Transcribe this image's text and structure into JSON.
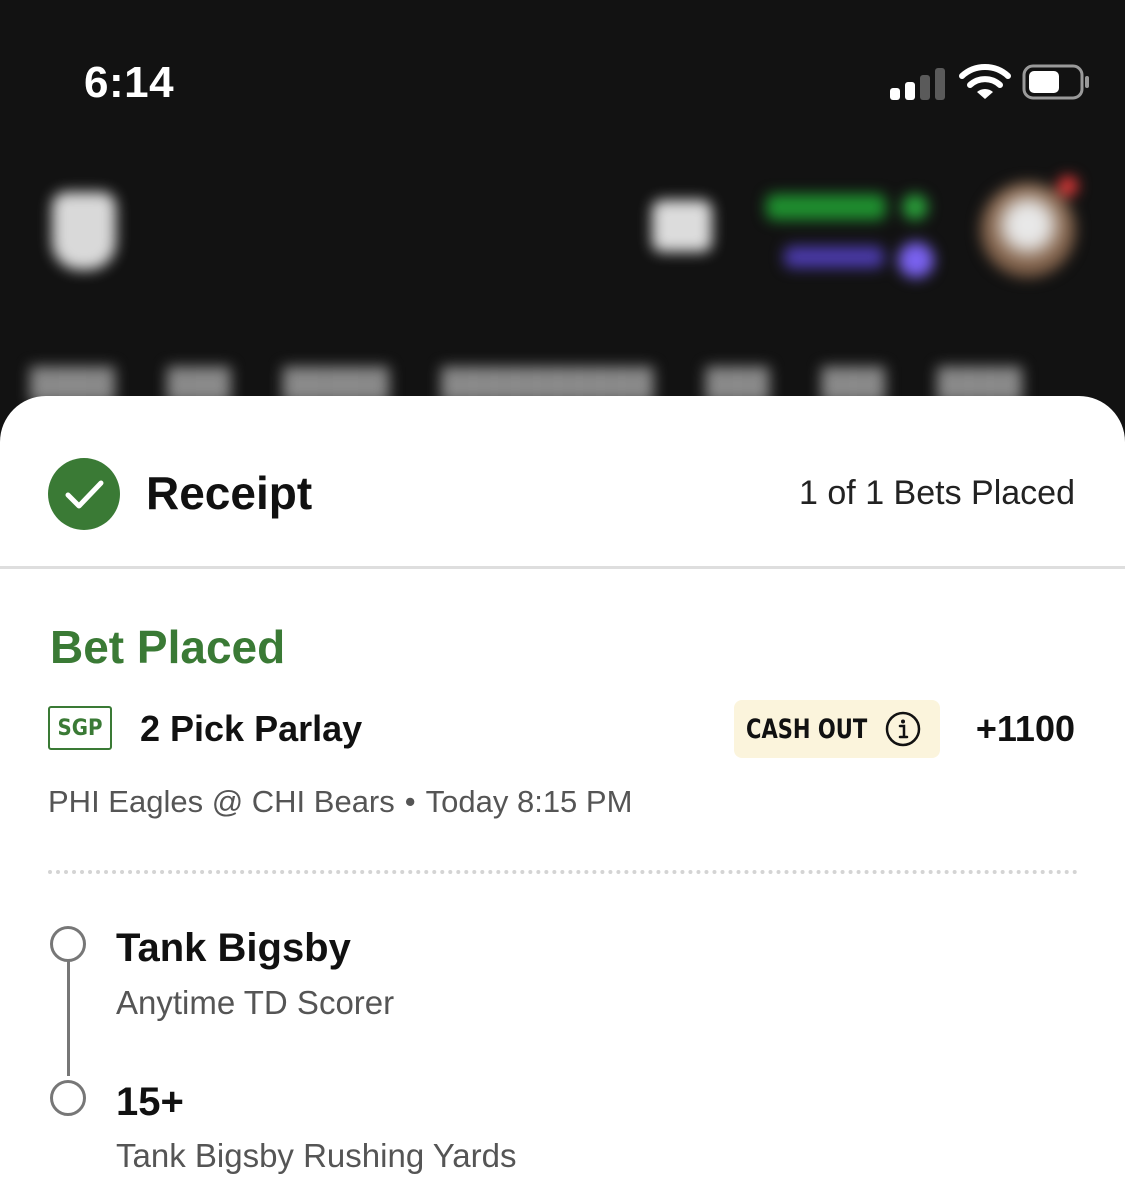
{
  "status_bar": {
    "time": "6:14",
    "icons": [
      "cellular-signal-icon",
      "wifi-icon",
      "battery-icon"
    ]
  },
  "app_header": {
    "icons": [
      "crown-logo-icon",
      "gift-icon",
      "add-funds-icon",
      "bonus-icon",
      "avatar"
    ]
  },
  "receipt": {
    "title": "Receipt",
    "bets_count": "1 of 1 Bets Placed",
    "status_color": "#3a7a35"
  },
  "bet": {
    "status": "Bet Placed",
    "badge": "SGP",
    "title": "2 Pick Parlay",
    "cash_out_label": "CASH OUT",
    "odds": "+1100",
    "matchup": "PHI Eagles @ CHI Bears",
    "separator": "•",
    "start_time": "Today 8:15 PM",
    "legs": [
      {
        "title": "Tank Bigsby",
        "market": "Anytime TD Scorer"
      },
      {
        "title": "15+",
        "market": "Tank Bigsby Rushing Yards"
      }
    ]
  }
}
